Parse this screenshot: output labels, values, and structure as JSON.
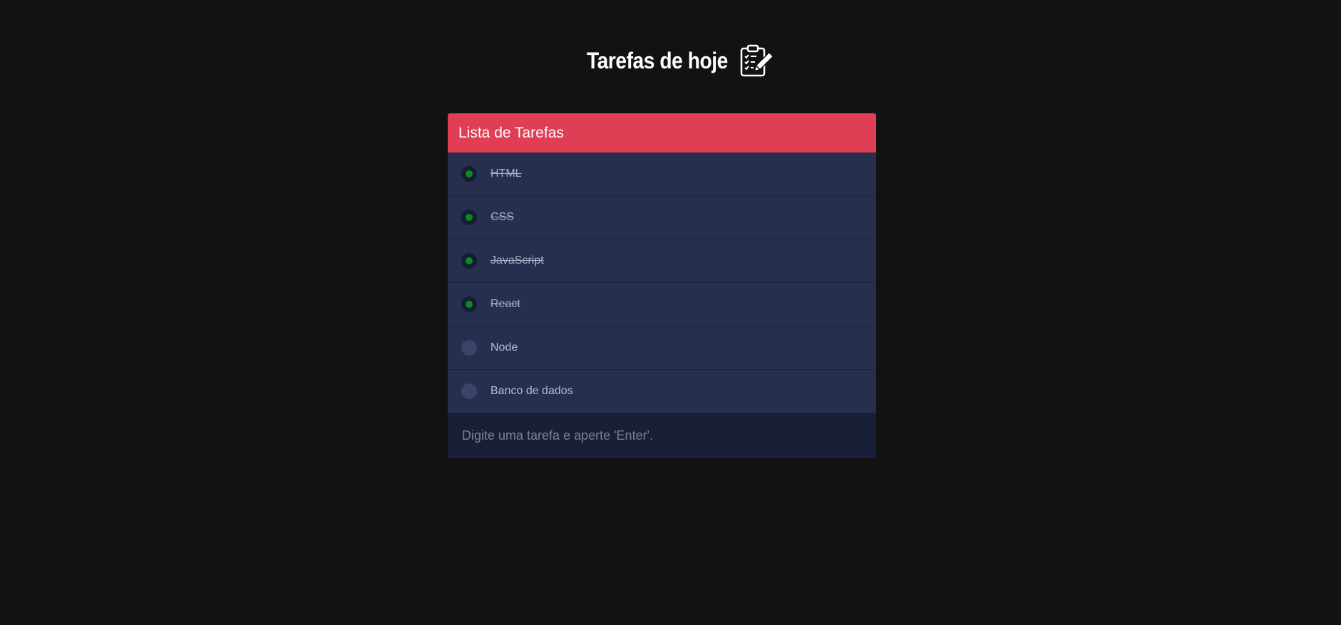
{
  "header": {
    "title": "Tarefas de hoje",
    "icon": "clipboard-checklist-icon"
  },
  "card": {
    "title": "Lista de Tarefas",
    "accent_color": "#e03e54",
    "tasks": [
      {
        "label": "HTML",
        "done": true
      },
      {
        "label": "CSS",
        "done": true
      },
      {
        "label": "JavaScript",
        "done": true
      },
      {
        "label": "React",
        "done": true
      },
      {
        "label": "Node",
        "done": false
      },
      {
        "label": "Banco de dados",
        "done": false
      }
    ],
    "input": {
      "placeholder": "Digite uma tarefa e aperte 'Enter'.",
      "value": ""
    }
  },
  "colors": {
    "background": "#121212",
    "card_body": "#262f4e",
    "input_background": "#1a1f38",
    "done_indicator": "#0b8a1e"
  }
}
